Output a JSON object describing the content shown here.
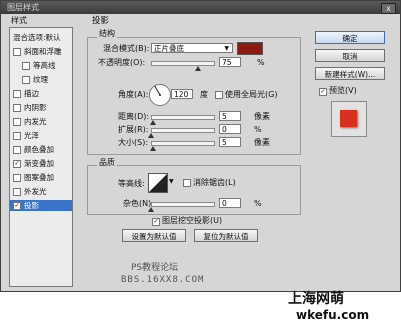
{
  "window": {
    "title": "图层样式",
    "close_glyph": "x"
  },
  "styles_panel": {
    "header": "样式",
    "items": [
      {
        "label": "混合选项:默认",
        "checkbox": false,
        "checked": false,
        "indent": false,
        "selected": false
      },
      {
        "label": "斜面和浮雕",
        "checkbox": true,
        "checked": false,
        "indent": false,
        "selected": false
      },
      {
        "label": "等高线",
        "checkbox": true,
        "checked": false,
        "indent": true,
        "selected": false
      },
      {
        "label": "纹理",
        "checkbox": true,
        "checked": false,
        "indent": true,
        "selected": false
      },
      {
        "label": "描边",
        "checkbox": true,
        "checked": false,
        "indent": false,
        "selected": false
      },
      {
        "label": "内阴影",
        "checkbox": true,
        "checked": false,
        "indent": false,
        "selected": false
      },
      {
        "label": "内发光",
        "checkbox": true,
        "checked": false,
        "indent": false,
        "selected": false
      },
      {
        "label": "光泽",
        "checkbox": true,
        "checked": false,
        "indent": false,
        "selected": false
      },
      {
        "label": "颜色叠加",
        "checkbox": true,
        "checked": false,
        "indent": false,
        "selected": false
      },
      {
        "label": "渐变叠加",
        "checkbox": true,
        "checked": true,
        "indent": false,
        "selected": false
      },
      {
        "label": "图案叠加",
        "checkbox": true,
        "checked": false,
        "indent": false,
        "selected": false
      },
      {
        "label": "外发光",
        "checkbox": true,
        "checked": false,
        "indent": false,
        "selected": false
      },
      {
        "label": "投影",
        "checkbox": true,
        "checked": true,
        "indent": false,
        "selected": true
      }
    ]
  },
  "drop_shadow": {
    "section_title": "投影",
    "structure": {
      "group_title": "结构",
      "blend_mode_label": "混合模式(B):",
      "blend_mode_value": "正片叠底",
      "shadow_color": "#8b1a10",
      "opacity_label": "不透明度(O):",
      "opacity_value": "75",
      "opacity_unit": "%",
      "opacity_fraction": 0.75,
      "angle_label": "角度(A):",
      "angle_value": "120",
      "angle_unit": "度",
      "use_global_light_label": "使用全局光(G)",
      "use_global_light_checked": false,
      "distance_label": "距离(D):",
      "distance_value": "5",
      "distance_unit": "像素",
      "distance_fraction": 0.03,
      "spread_label": "扩展(R):",
      "spread_value": "0",
      "spread_unit": "%",
      "spread_fraction": 0.0,
      "size_label": "大小(S):",
      "size_value": "5",
      "size_unit": "像素",
      "size_fraction": 0.03
    },
    "quality": {
      "group_title": "品质",
      "contour_label": "等高线:",
      "anti_aliased_label": "消除锯齿(L)",
      "anti_aliased_checked": false,
      "noise_label": "杂色(N):",
      "noise_value": "0",
      "noise_unit": "%",
      "noise_fraction": 0.0
    },
    "knockout_label": "图层挖空投影(U)",
    "knockout_checked": true,
    "set_default_button": "设置为默认值",
    "reset_default_button": "复位为默认值"
  },
  "buttons": {
    "ok": "确定",
    "cancel": "取消",
    "new_style": "新建样式(W)...",
    "preview_label": "预览(V)",
    "preview_checked": true
  },
  "preview_swatch_color": "#d8321e",
  "watermarks": {
    "forum": "PS教程论坛",
    "forum_url": "BBS.16XX8.COM",
    "site_name": "上海网萌",
    "site_url": "wkefu.com"
  }
}
